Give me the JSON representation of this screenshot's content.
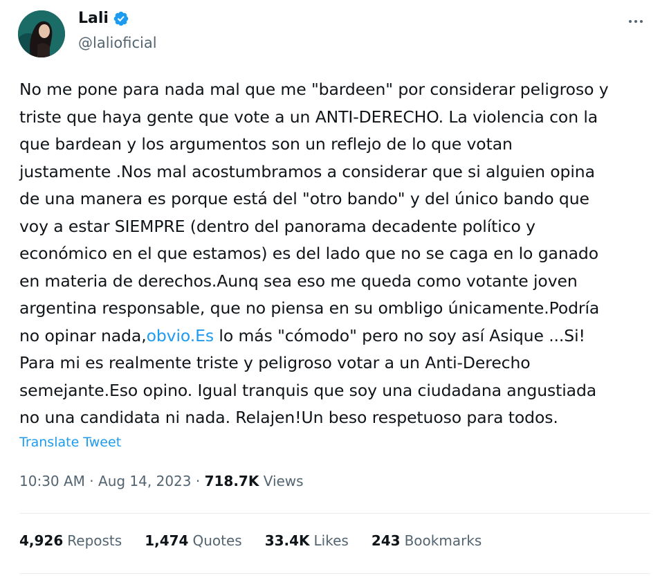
{
  "author": {
    "name": "Lali",
    "handle": "@lalioficial",
    "verified_icon": "verified-badge-icon",
    "avatar_icon": "profile-photo"
  },
  "menu_icon": "more-options-icon",
  "tweet": {
    "text_before_link": "No me pone para nada mal que me \"bardeen\" por considerar peligroso y\ntriste que haya gente que vote a un ANTI-DERECHO. La violencia con la\nque bardean y los argumentos son un reflejo de lo que votan\njustamente .Nos mal acostumbramos a considerar que si alguien opina\nde una manera es porque está del \"otro bando\" y del único bando que\nvoy a estar SIEMPRE (dentro del panorama decadente político y\neconómico en el que estamos) es del lado que no se caga en lo ganado\nen materia de derechos.Aunq sea eso me queda como votante joven\nargentina responsable, que no piensa en su ombligo únicamente.Podría\nno opinar nada,",
    "link_text": "obvio.Es",
    "text_after_link": " lo más \"cómodo\" pero no soy así Asique ...Si!\nPara mi es realmente triste y peligroso votar a un Anti-Derecho\nsemejante.Eso opino. Igual tranquis que soy una ciudadana angustiada\nno una candidata ni nada. Relajen!Un beso respetuoso para todos.",
    "translate_label": "Translate Tweet"
  },
  "meta": {
    "time": "10:30 AM",
    "separator": "·",
    "date": "Aug 14, 2023",
    "views_count": "718.7K",
    "views_label": "Views"
  },
  "stats": [
    {
      "count": "4,926",
      "label": "Reposts"
    },
    {
      "count": "1,474",
      "label": "Quotes"
    },
    {
      "count": "33.4K",
      "label": "Likes"
    },
    {
      "count": "243",
      "label": "Bookmarks"
    }
  ],
  "colors": {
    "link": "#1d9bf0",
    "secondary_text": "#536471",
    "primary_text": "#0f1419",
    "divider": "#e6ecf0"
  }
}
